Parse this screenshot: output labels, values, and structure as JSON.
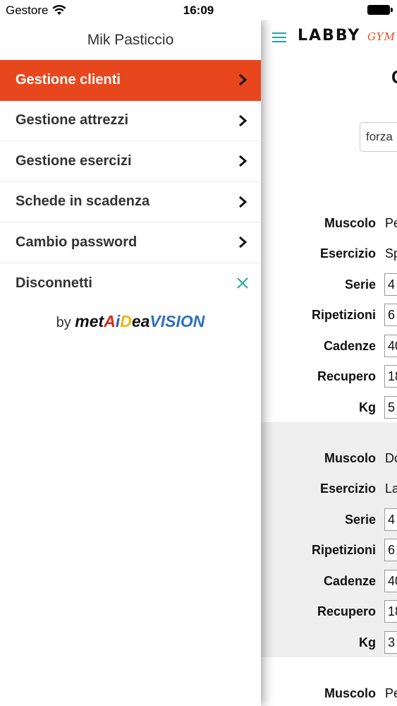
{
  "status_bar": {
    "carrier": "Gestore",
    "time": "16:09"
  },
  "drawer": {
    "user_name": "Mik Pasticcio",
    "items": [
      {
        "label": "Gestione clienti",
        "icon": "chevron-right-icon",
        "active": true
      },
      {
        "label": "Gestione attrezzi",
        "icon": "chevron-right-icon"
      },
      {
        "label": "Gestione esercizi",
        "icon": "chevron-right-icon"
      },
      {
        "label": "Schede in scadenza",
        "icon": "chevron-right-icon"
      },
      {
        "label": "Cambio password",
        "icon": "chevron-right-icon"
      },
      {
        "label": "Disconnetti",
        "icon": "close-icon"
      }
    ],
    "byline": {
      "prefix": "by",
      "brand_met": "met",
      "brand_a": "A",
      "brand_i": "i",
      "brand_d": "D",
      "brand_ea": "ea",
      "brand_vision": "VISION"
    }
  },
  "app": {
    "logo_main": "LABBY",
    "logo_sub": "GYM",
    "heading": "C",
    "search_value": "forza",
    "exercises": [
      {
        "muscolo_label": "Muscolo",
        "muscolo": "Pe",
        "esercizio_label": "Esercizio",
        "esercizio": "Sp",
        "serie_label": "Serie",
        "serie": "4",
        "ripetizioni_label": "Ripetizioni",
        "ripetizioni": "6",
        "cadenze_label": "Cadenze",
        "cadenze": "40",
        "recupero_label": "Recupero",
        "recupero": "18",
        "kg_label": "Kg",
        "kg": "5"
      },
      {
        "muscolo_label": "Muscolo",
        "muscolo": "Do",
        "esercizio_label": "Esercizio",
        "esercizio": "La",
        "serie_label": "Serie",
        "serie": "4",
        "ripetizioni_label": "Ripetizioni",
        "ripetizioni": "6",
        "cadenze_label": "Cadenze",
        "cadenze": "40",
        "recupero_label": "Recupero",
        "recupero": "18",
        "kg_label": "Kg",
        "kg": "3"
      },
      {
        "muscolo_label": "Muscolo",
        "muscolo": "Pe"
      }
    ]
  },
  "colors": {
    "accent": "#e8471d",
    "hamburger": "#27a59a",
    "close": "#27a59a"
  }
}
